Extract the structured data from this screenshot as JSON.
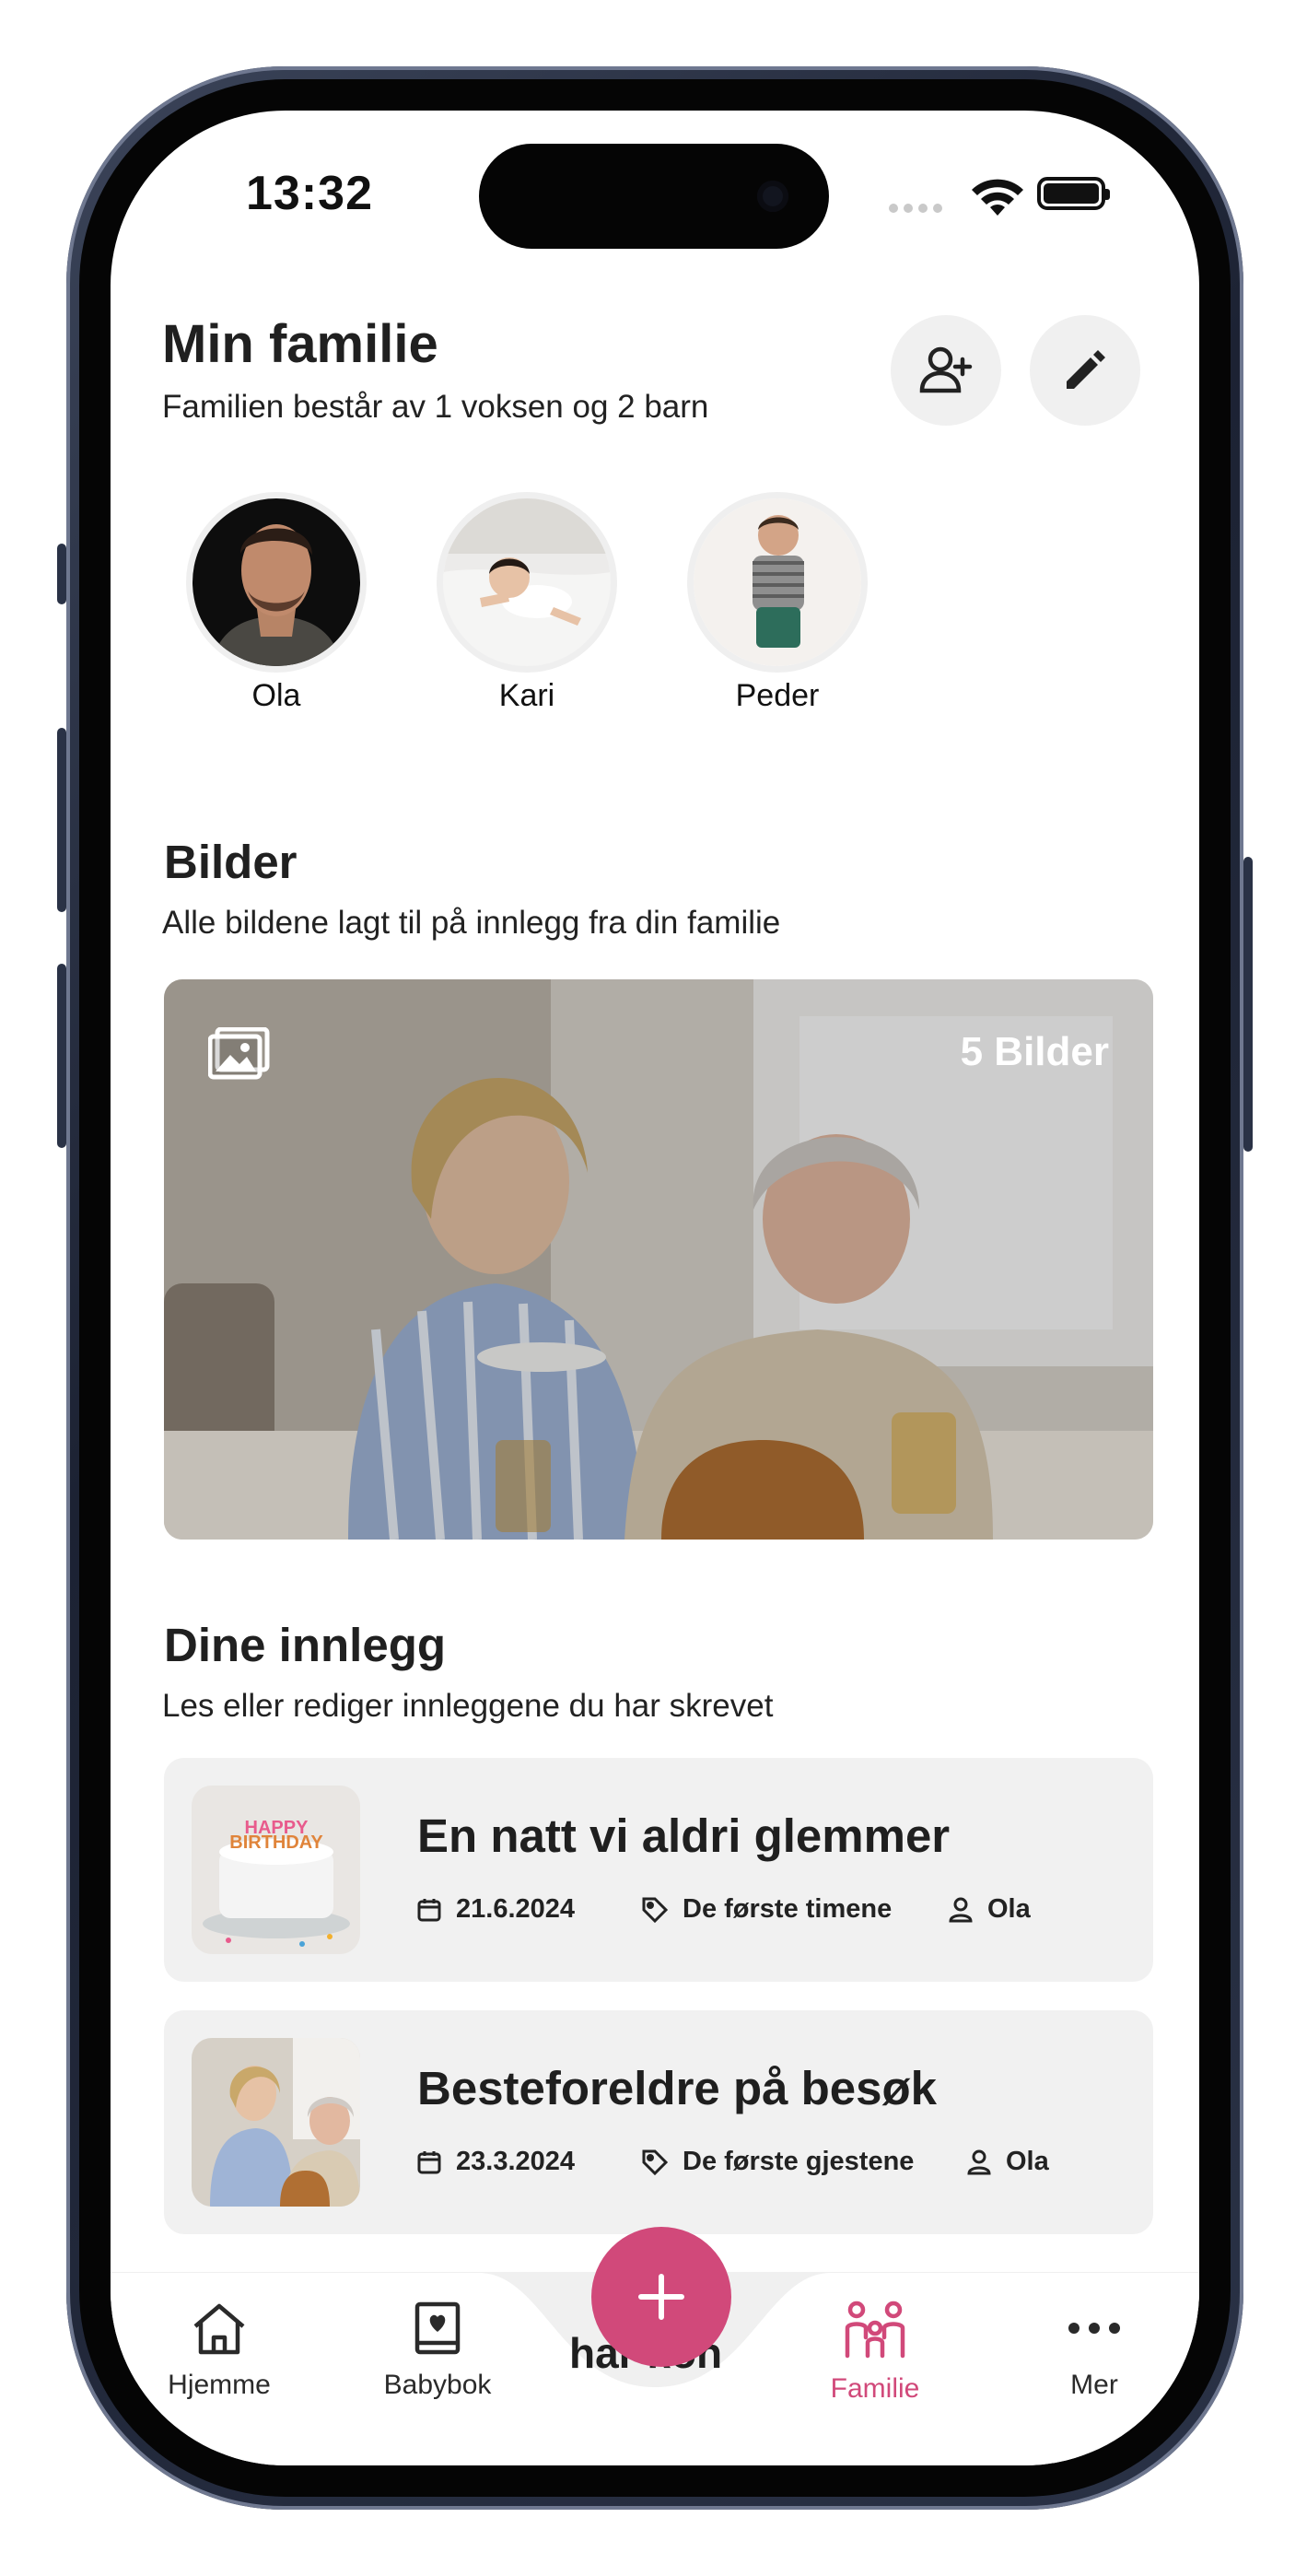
{
  "status_bar": {
    "time": "13:32"
  },
  "header": {
    "title": "Min familie",
    "subtitle": "Familien består av 1 voksen og 2 barn"
  },
  "members": [
    {
      "name": "Ola"
    },
    {
      "name": "Kari"
    },
    {
      "name": "Peder"
    }
  ],
  "photos": {
    "title": "Bilder",
    "subtitle": "Alle bildene lagt til på innlegg fra din familie",
    "count_label": "5 Bilder"
  },
  "posts_section": {
    "title": "Dine innlegg",
    "subtitle": "Les eller rediger innleggene du har skrevet"
  },
  "posts": [
    {
      "title": "En natt vi aldri glemmer",
      "date": "21.6.2024",
      "tag": "De første timene",
      "author": "Ola"
    },
    {
      "title": "Besteforeldre på besøk",
      "date": "23.3.2024",
      "tag": "De første gjestene",
      "author": "Ola"
    }
  ],
  "tabbar": {
    "home": "Hjemme",
    "babybook": "Babybok",
    "family": "Familie",
    "more": "Mer",
    "hidden_text": "har kon"
  },
  "colors": {
    "accent": "#d1497a",
    "card": "#f1f1f1",
    "text": "#202020"
  },
  "icons": [
    "add-person-icon",
    "pencil-icon",
    "gallery-icon",
    "calendar-icon",
    "tag-icon",
    "person-icon",
    "home-icon",
    "babybook-icon",
    "family-icon",
    "more-icon",
    "plus-icon"
  ]
}
